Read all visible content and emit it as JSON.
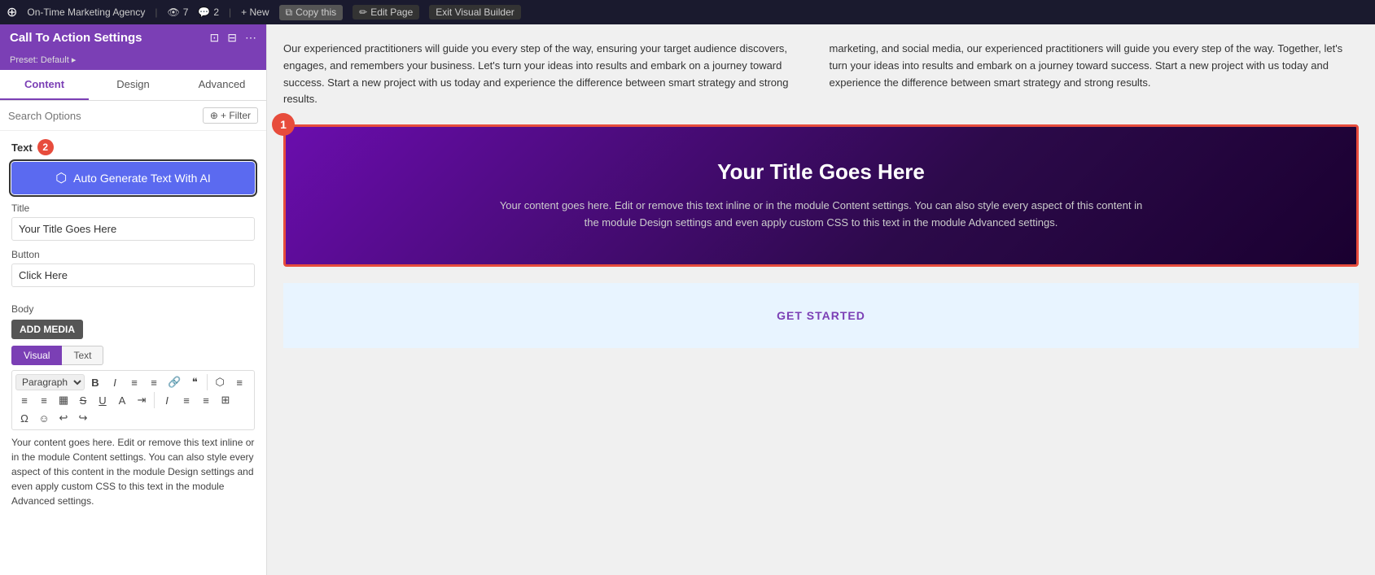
{
  "topbar": {
    "wp_icon": "W",
    "site_name": "On-Time Marketing Agency",
    "views_icon": "👁",
    "views_count": "7",
    "comments_icon": "💬",
    "comments_count": "2",
    "new_label": "+ New",
    "copy_label": "Copy this",
    "edit_label": "Edit Page",
    "exit_label": "Exit Visual Builder"
  },
  "sidebar": {
    "title": "Call To Action Settings",
    "preset": "Preset: Default ▸",
    "tabs": [
      "Content",
      "Design",
      "Advanced"
    ],
    "active_tab": "Content",
    "search_placeholder": "Search Options",
    "filter_label": "+ Filter",
    "text_section_label": "Text",
    "text_badge": "2",
    "ai_btn_label": "Auto Generate Text With AI",
    "title_label": "Title",
    "title_value": "Your Title Goes Here",
    "button_label": "Button",
    "button_value": "Click Here",
    "body_label": "Body",
    "add_media_label": "ADD MEDIA",
    "editor_tabs": [
      "Visual",
      "Text"
    ],
    "active_editor_tab": "Visual",
    "paragraph_label": "Paragraph",
    "body_text": "Your content goes here. Edit or remove this text inline or in the module Content settings. You can also style every aspect of this content in the module Design settings and even apply custom CSS to this text in the module Advanced settings.",
    "toolbar_items": [
      "B",
      "I",
      "≡",
      "≡",
      "🔗",
      "\"",
      "≡",
      "≡",
      "≡",
      "≡",
      "▦",
      "S",
      "U",
      "A",
      "✦",
      "Ι",
      "≡",
      "≡",
      "⊞",
      "Ω",
      "☺",
      "↩",
      "↪"
    ]
  },
  "main": {
    "col1_text": "Our experienced practitioners will guide you every step of the way, ensuring your target audience discovers, engages, and remembers your business. Let's turn your ideas into results and embark on a journey toward success. Start a new project with us today and experience the difference between smart strategy and strong results.",
    "col2_text": "marketing, and social media, our experienced practitioners will guide you every step of the way. Together, let's turn your ideas into results and embark on a journey toward success. Start a new project with us today and experience the difference between smart strategy and strong results.",
    "cta_badge": "1",
    "cta_title": "Your Title Goes Here",
    "cta_body": "Your content goes here. Edit or remove this text inline or in the module Content settings. You can also style every aspect of this content in the module Design settings and even apply custom CSS to this text in the module Advanced settings.",
    "bottom_label": "GET STARTED"
  }
}
